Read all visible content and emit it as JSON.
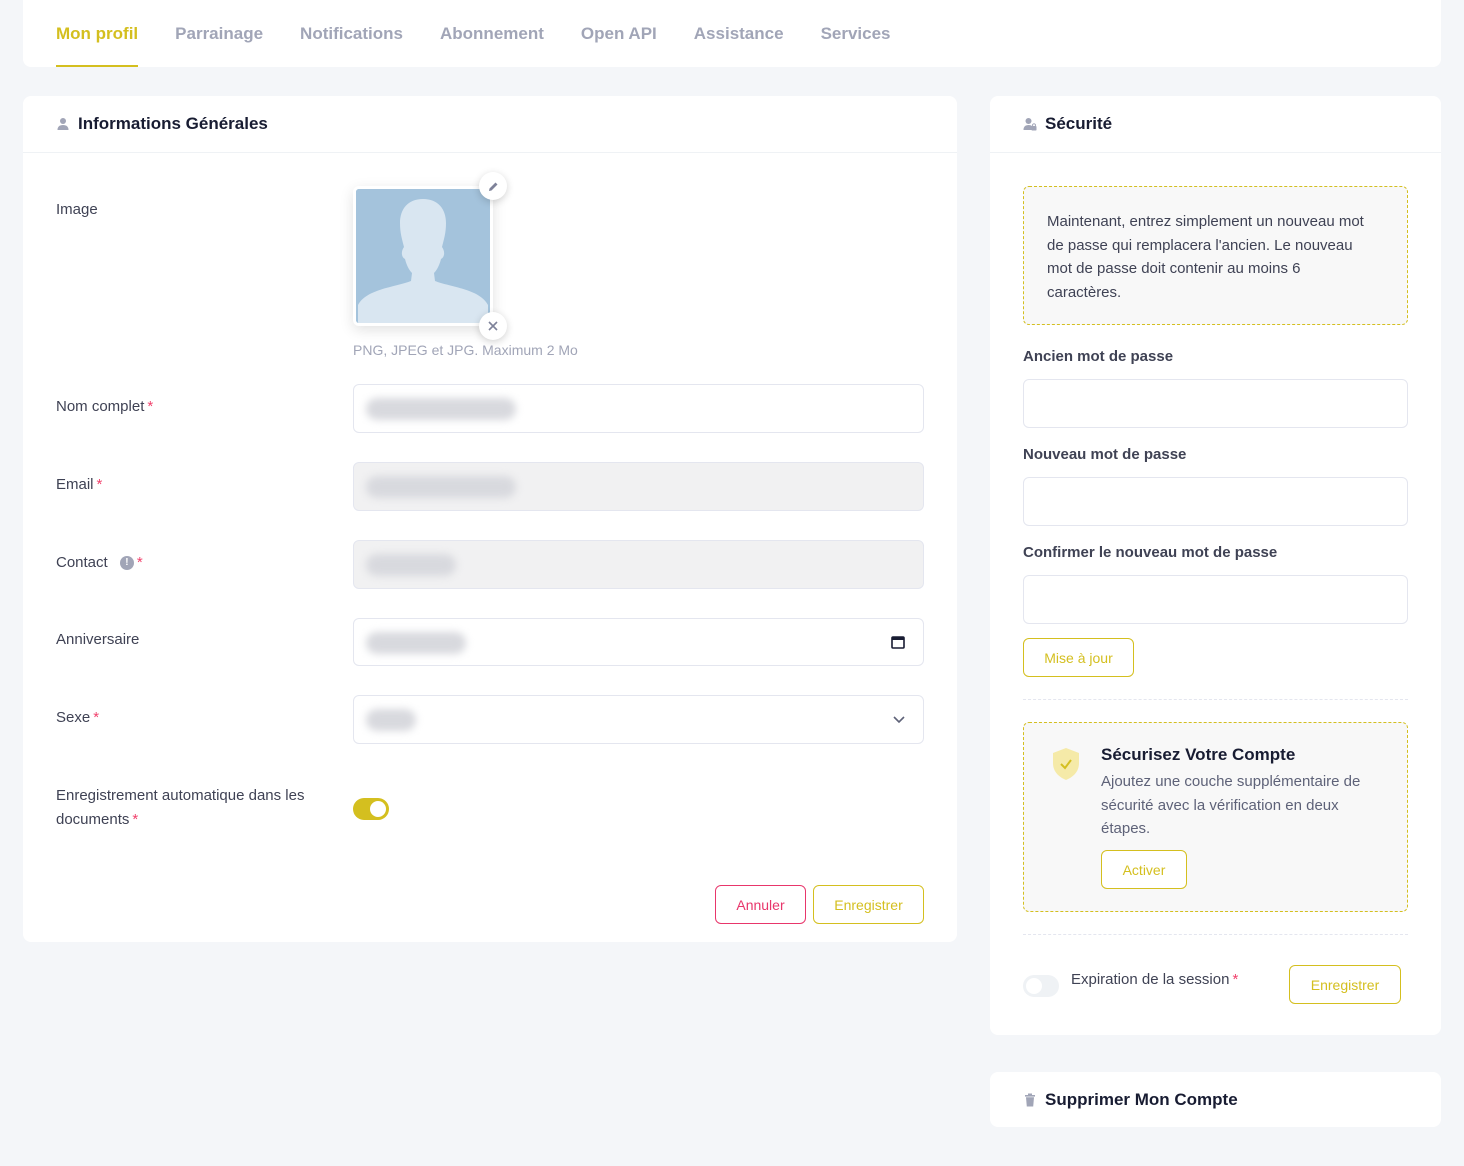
{
  "tabs": [
    {
      "label": "Mon profil",
      "active": true
    },
    {
      "label": "Parrainage"
    },
    {
      "label": "Notifications"
    },
    {
      "label": "Abonnement"
    },
    {
      "label": "Open API"
    },
    {
      "label": "Assistance"
    },
    {
      "label": "Services"
    }
  ],
  "info": {
    "title": "Informations Générales",
    "image_label": "Image",
    "image_hint": "PNG, JPEG et JPG. Maximum 2 Mo",
    "name_label": "Nom complet",
    "email_label": "Email",
    "contact_label": "Contact",
    "birthday_label": "Anniversaire",
    "sex_label": "Sexe",
    "autosave_label": "Enregistrement automatique dans les documents",
    "autosave_on": true,
    "required_mark": "*",
    "cancel_label": "Annuler",
    "save_label": "Enregistrer"
  },
  "security": {
    "title": "Sécurité",
    "notice": "Maintenant, entrez simplement un nouveau mot de passe qui remplacera l'ancien. Le nouveau mot de passe doit contenir au moins 6 caractères.",
    "old_pw_label": "Ancien mot de passe",
    "new_pw_label": "Nouveau mot de passe",
    "confirm_pw_label": "Confirmer le nouveau mot de passe",
    "update_label": "Mise à jour",
    "twofa_title": "Sécurisez Votre Compte",
    "twofa_text": "Ajoutez une couche supplémentaire de sécurité avec la vérification en deux étapes.",
    "activate_label": "Activer",
    "session_label": "Expiration de la session",
    "session_on": false,
    "save_label": "Enregistrer"
  },
  "delete": {
    "title": "Supprimer Mon Compte"
  },
  "colors": {
    "accent": "#d4bf1f",
    "danger": "#e8366b",
    "muted": "#a1a5b7"
  }
}
